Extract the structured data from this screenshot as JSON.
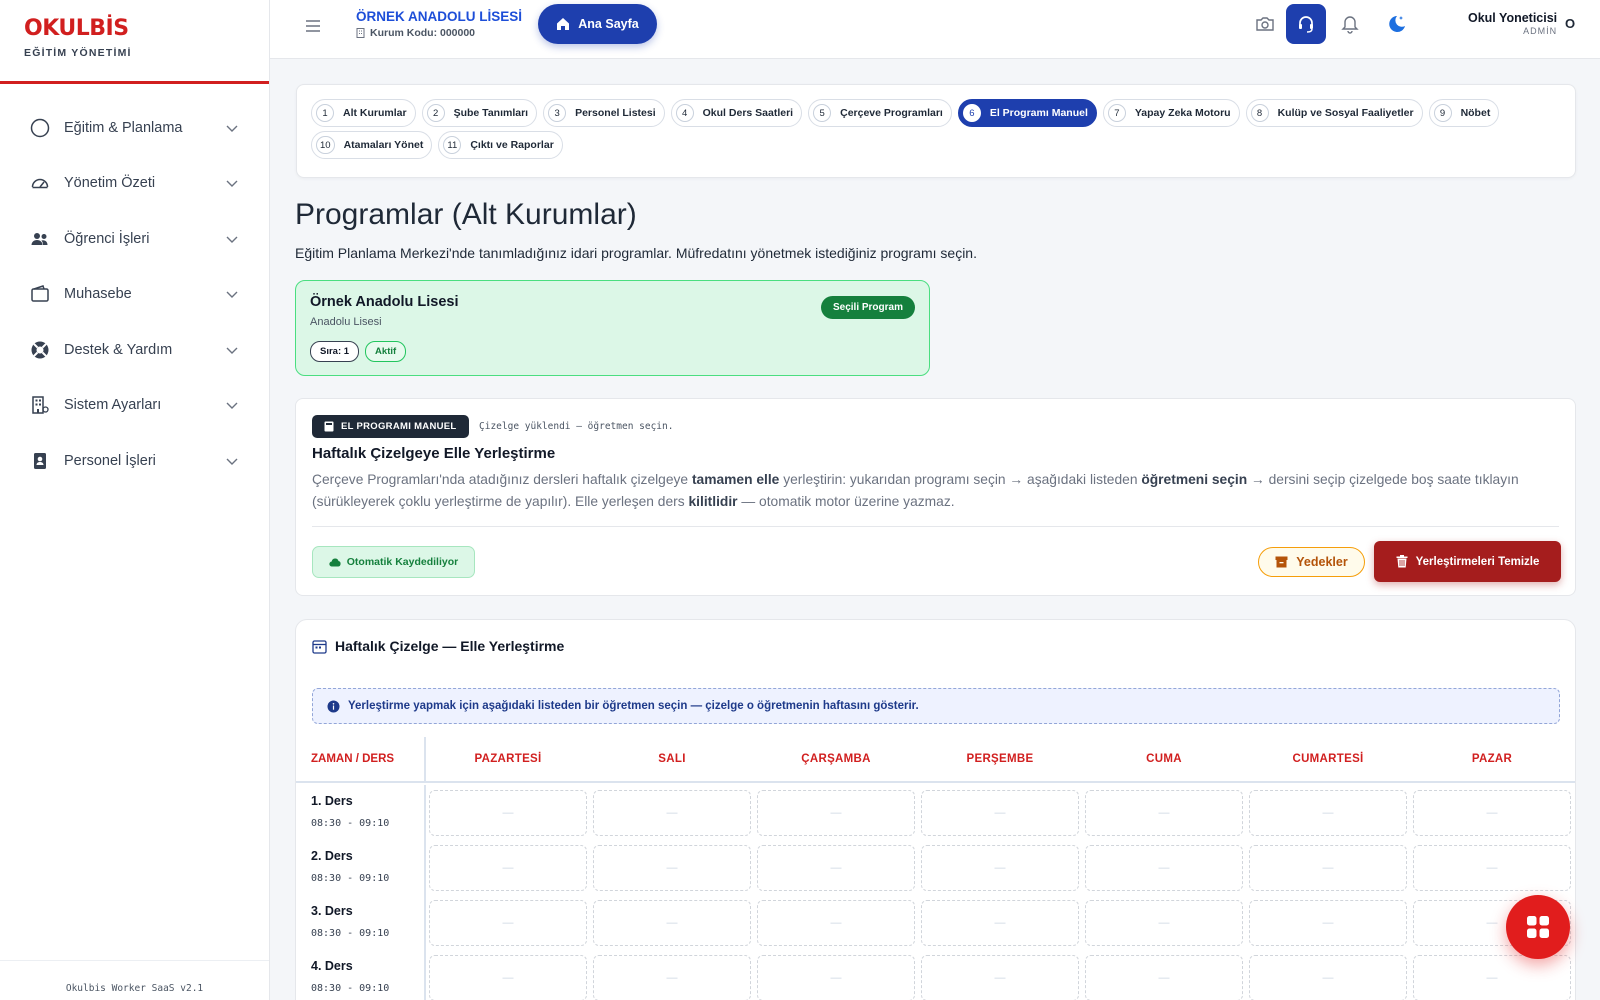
{
  "brand": {
    "name": "OKULBİS",
    "subtitle": "EĞİTİM YÖNETİMİ",
    "accent": "#d11f1f"
  },
  "sidebar": {
    "items": [
      {
        "label": "Eğitim & Planlama",
        "icon": "circle-icon"
      },
      {
        "label": "Yönetim Özeti",
        "icon": "gauge-icon"
      },
      {
        "label": "Öğrenci İşleri",
        "icon": "users-icon"
      },
      {
        "label": "Muhasebe",
        "icon": "wallet-icon"
      },
      {
        "label": "Destek & Yardım",
        "icon": "lifebuoy-icon"
      },
      {
        "label": "Sistem Ayarları",
        "icon": "building-icon"
      },
      {
        "label": "Personel İşleri",
        "icon": "id-badge-icon"
      }
    ],
    "footer": "Okulbis Worker SaaS v2.1"
  },
  "topbar": {
    "school_name": "ÖRNEK ANADOLU LİSESİ",
    "school_code": "Kurum Kodu: 000000",
    "home_label": "Ana Sayfa",
    "user_name": "Okul Yoneticisi",
    "user_role": "ADMİN",
    "user_initial": "O",
    "primary_color": "#1e3fae"
  },
  "steps": [
    {
      "num": "1",
      "label": "Alt Kurumlar",
      "active": false
    },
    {
      "num": "2",
      "label": "Şube Tanımları",
      "active": false
    },
    {
      "num": "3",
      "label": "Personel Listesi",
      "active": false
    },
    {
      "num": "4",
      "label": "Okul Ders Saatleri",
      "active": false
    },
    {
      "num": "5",
      "label": "Çerçeve Programları",
      "active": false
    },
    {
      "num": "6",
      "label": "El Programı Manuel",
      "active": true
    },
    {
      "num": "7",
      "label": "Yapay Zeka Motoru",
      "active": false
    },
    {
      "num": "8",
      "label": "Kulüp ve Sosyal Faaliyetler",
      "active": false
    },
    {
      "num": "9",
      "label": "Nöbet",
      "active": false
    },
    {
      "num": "10",
      "label": "Atamaları Yönet",
      "active": false
    },
    {
      "num": "11",
      "label": "Çıktı ve Raporlar",
      "active": false
    }
  ],
  "page": {
    "title": "Programlar (Alt Kurumlar)",
    "description": "Eğitim Planlama Merkezi'nde tanımladığınız idari programlar. Müfredatını yönetmek istediğiniz programı seçin."
  },
  "program_card": {
    "name": "Örnek Anadolu Lisesi",
    "type": "Anadolu Lisesi",
    "badge": "Seçili Program",
    "order": "Sıra: 1",
    "status": "Aktif"
  },
  "manual": {
    "tag": "EL PROGRAMI MANUEL",
    "status": "Çizelge yüklendi — öğretmen seçin.",
    "title": "Haftalık Çizelgeye Elle Yerleştirme",
    "desc_parts": [
      "Çerçeve Programları'nda atadığınız dersleri haftalık çizelgeye ",
      "tamamen elle",
      " yerleştirin: yukarıdan programı seçin → aşağıdaki listeden ",
      "öğretmeni seçin",
      " → dersini seçip çizelgede boş saate tıklayın (sürükleyerek çoklu yerleştirme de yapılır). Elle yerleşen ders ",
      "kilitlidir",
      " — otomatik motor üzerine yazmaz."
    ],
    "auto_save": "Otomatik Kaydediliyor",
    "backup": "Yedekler",
    "clear": "Yerleştirmeleri Temizle"
  },
  "schedule": {
    "title": "Haftalık Çizelge — Elle Yerleştirme",
    "info": "Yerleştirme yapmak için aşağıdaki listeden bir öğretmen seçin — çizelge o öğretmenin haftasını gösterir.",
    "time_header": "ZAMAN / DERS",
    "days": [
      "PAZARTESİ",
      "SALI",
      "ÇARŞAMBA",
      "PERŞEMBE",
      "CUMA",
      "CUMARTESİ",
      "PAZAR"
    ],
    "rows": [
      {
        "name": "1. Ders",
        "hours": "08:30 - 09:10"
      },
      {
        "name": "2. Ders",
        "hours": "08:30 - 09:10"
      },
      {
        "name": "3. Ders",
        "hours": "08:30 - 09:10"
      },
      {
        "name": "4. Ders",
        "hours": "08:30 - 09:10"
      }
    ],
    "empty_cell": "—"
  }
}
